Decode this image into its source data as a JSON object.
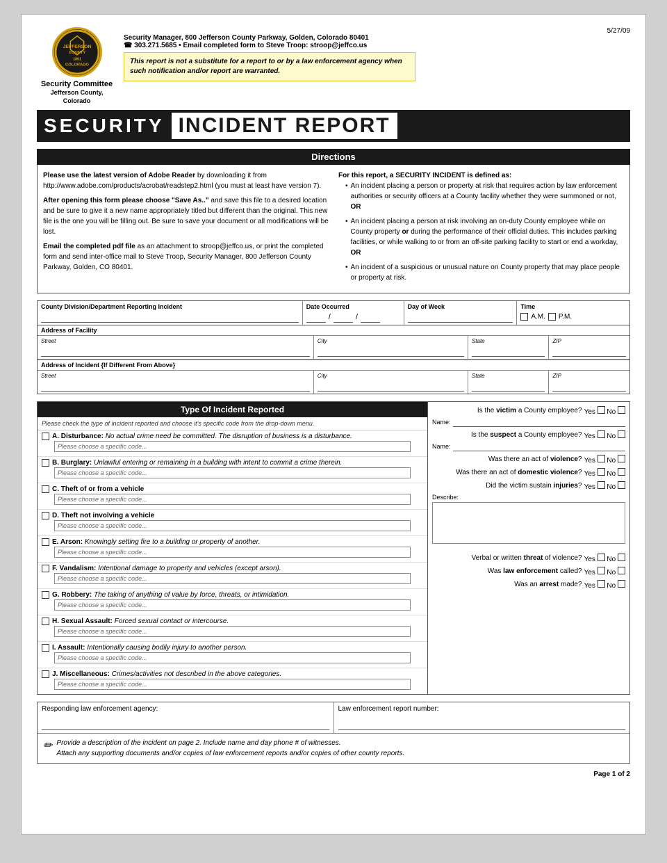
{
  "meta": {
    "date": "5/27/09",
    "page": "Page 1 of 2"
  },
  "header": {
    "logo_lines": [
      "JEFFERSON",
      "COUNTY",
      "1861",
      "COLORADO"
    ],
    "org_name": "Security Committee",
    "org_sub": "Jefferson County, Colorado",
    "contact_line1": "Security Manager, 800 Jefferson County Parkway, Golden, Colorado 80401",
    "contact_line2": "☎ 303.271.5685  •  Email completed form to Steve Troop: stroop@jeffco.us",
    "warning": "This report is not a substitute for a report to or by a law enforcement agency when such notification and/or report are warranted."
  },
  "title": {
    "security": "SECURITY",
    "incident_report": "INCIDENT REPORT"
  },
  "directions": {
    "header": "Directions",
    "left": {
      "p1_bold": "Please use the latest version of Adobe Reader",
      "p1_rest": " by downloading it from http://www.adobe.com/products/acrobat/readstep2.html (you must at least have version 7).",
      "p2_bold": "After opening this form please choose \"Save As..\"",
      "p2_rest": " and save this file to a desired location and be sure to give it a new name appropriately titled but different than the original. This new file is the one you will be filling out. Be sure to save your document or all modifications will be lost.",
      "p3_bold": "Email the completed pdf file",
      "p3_rest": " as an attachment to stroop@jeffco.us, or print the completed form and send inter-office mail to Steve Troop, Security Manager, 800 Jefferson County Parkway, Golden, CO 80401."
    },
    "right": {
      "title": "For this report, a SECURITY INCIDENT is defined as:",
      "bullets": [
        "An incident placing a person or property at risk that requires action by law enforcement authorities or security officers at a County facility whether they were summoned or not, OR",
        "An incident placing a person at risk involving an on-duty County employee while on County property or during the performance of their official duties. This includes parking facilities, or while walking to or from an off-site parking facility to start or end a workday, OR",
        "An incident of a suspicious or unusual nature on County property that may place people or property at risk."
      ]
    }
  },
  "form_fields": {
    "county_division_label": "County Division/Department Reporting Incident",
    "date_occurred_label": "Date Occurred",
    "day_of_week_label": "Day of Week",
    "time_label": "Time",
    "am_label": "A.M.",
    "pm_label": "P.M.",
    "address_facility_label": "Address of Facility",
    "street_label": "Street",
    "city_label": "City",
    "state_label": "State",
    "zip_label": "ZIP",
    "address_incident_label": "Address of Incident {If Different From Above}",
    "street2_label": "Street",
    "city2_label": "City",
    "state2_label": "State",
    "zip2_label": "ZIP"
  },
  "incident_types": {
    "header": "Type Of Incident Reported",
    "note": "Please check the type of incident reported and choose it's specific code from the drop-down menu.",
    "dropdown_placeholder": "Please choose a specific code...",
    "items": [
      {
        "letter": "A",
        "label": "Disturbance:",
        "desc": " No actual crime need be committed. The disruption of business is a disturbance."
      },
      {
        "letter": "B",
        "label": "Burglary:",
        "desc": " Unlawful entering or remaining in a building with intent to commit a crime therein."
      },
      {
        "letter": "C",
        "label": "Theft of or from a vehicle",
        "desc": ""
      },
      {
        "letter": "D",
        "label": "Theft not involving a vehicle",
        "desc": ""
      },
      {
        "letter": "E",
        "label": "Arson:",
        "desc": " Knowingly setting fire to a building or property of another."
      },
      {
        "letter": "F",
        "label": "Vandalism:",
        "desc": " Intentional damage to property and vehicles (except arson)."
      },
      {
        "letter": "G",
        "label": "Robbery:",
        "desc": " The taking of anything of value by force, threats, or intimidation."
      },
      {
        "letter": "H",
        "label": "Sexual Assault:",
        "desc": " Forced sexual contact or intercourse."
      },
      {
        "letter": "I",
        "label": "Assault:",
        "desc": " Intentionally causing bodily injury to another person."
      },
      {
        "letter": "J",
        "label": "Miscellaneous:",
        "desc": " Crimes/activities not described in the above categories."
      }
    ],
    "right_questions": [
      {
        "text": "Is the victim a County employee?",
        "bold": "victim",
        "has_name": true,
        "name_label": "Name:"
      },
      {
        "text": "Is the suspect a County employee?",
        "bold": "suspect",
        "has_name": true,
        "name_label": "Name:"
      },
      {
        "text": "Was there an act of violence?",
        "bold": "violence",
        "has_name": false
      },
      {
        "text": "Was there an act of domestic violence?",
        "bold": "domestic violence",
        "has_name": false
      },
      {
        "text": "Did the victim sustain injuries?",
        "bold": "injuries",
        "has_name": false,
        "has_describe": true,
        "describe_label": "Describe:"
      }
    ],
    "bottom_questions": [
      {
        "text": "Verbal or written threat of violence?"
      },
      {
        "text": "Was law enforcement called?"
      },
      {
        "text": "Was an arrest made?"
      }
    ]
  },
  "bottom": {
    "law_enforcement_label": "Responding law enforcement agency:",
    "report_number_label": "Law enforcement report number:",
    "note": "Provide a description of the incident on page 2. Include name and day phone # of witnesses. Attach any supporting documents and/or copies of law enforcement reports and/or copies of other county reports."
  }
}
